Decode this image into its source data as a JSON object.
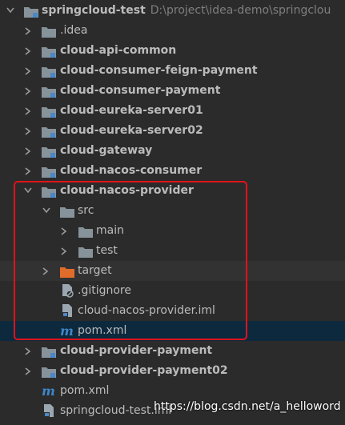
{
  "tree": {
    "root": {
      "name": "springcloud-test",
      "path": "D:\\project\\idea-demo\\springclou"
    },
    "items": [
      {
        "label": ".idea"
      },
      {
        "label": "cloud-api-common"
      },
      {
        "label": "cloud-consumer-feign-payment"
      },
      {
        "label": "cloud-consumer-payment"
      },
      {
        "label": "cloud-eureka-server01"
      },
      {
        "label": "cloud-eureka-server02"
      },
      {
        "label": "cloud-gateway"
      },
      {
        "label": "cloud-nacos-consumer"
      },
      {
        "label": "cloud-nacos-provider"
      },
      {
        "label": "src"
      },
      {
        "label": "main"
      },
      {
        "label": "test"
      },
      {
        "label": "target"
      },
      {
        "label": ".gitignore"
      },
      {
        "label": "cloud-nacos-provider.iml"
      },
      {
        "label": "pom.xml"
      },
      {
        "label": "cloud-provider-payment"
      },
      {
        "label": "cloud-provider-payment02"
      },
      {
        "label": "pom.xml"
      },
      {
        "label": "springcloud-test.iml"
      }
    ],
    "maven_glyph": "m"
  },
  "watermark": "https://blog.csdn.net/a_helloword",
  "colors": {
    "background": "#2b2b2b",
    "selected_row": "#0d293e",
    "folder_gray": "#87939a",
    "folder_orange": "#e06c2b",
    "module_blue": "#4a88c7",
    "highlight_red": "#e0131b"
  }
}
